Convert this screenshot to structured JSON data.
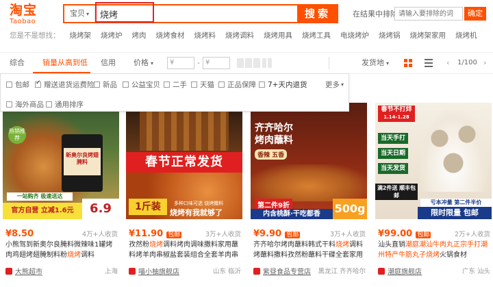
{
  "logo": {
    "cn": "淘宝",
    "en": "Taobao"
  },
  "search": {
    "category": "宝贝",
    "query": "烧烤",
    "button": "搜索",
    "exclude_label": "在结果中排除",
    "exclude_placeholder": "请输入要排除的词",
    "exclude_button": "确定"
  },
  "suggestions": {
    "label": "您是不是想找：",
    "items": [
      "烧烤架",
      "烧烤炉",
      "烤肉",
      "烧烤食材",
      "烧烤料",
      "烧烤调料",
      "烧烤用具",
      "烧烤工具",
      "电烧烤炉",
      "烧烤锅",
      "烧烤架家用",
      "烧烤机"
    ]
  },
  "sort": {
    "items": [
      "综合",
      "销量从高到低",
      "信用",
      "价格"
    ],
    "price_from": "¥",
    "price_to": "¥",
    "dash": "-",
    "ship_from": "发货地",
    "page": "1/100",
    "active_color": "#ff5000"
  },
  "filters": {
    "row1": [
      "包邮",
      "赠送退货运费险",
      "新品",
      "公益宝贝",
      "二手",
      "天猫",
      "正品保障",
      "7+天内退货"
    ],
    "more": "更多",
    "row2": [
      "海外商品",
      "通用排序"
    ],
    "checked_index": 1
  },
  "products": [
    {
      "price": "8.50",
      "sales": "4万+人收货",
      "title_pre": "小熊驾到新奥尔良腌料微辣味1罐烤肉鸡翅烤翅腌制料粉",
      "title_hl": "烧烤",
      "title_post": "调料",
      "shop": "大熊超市",
      "loc": "上海",
      "banner1": "热销推荐",
      "banner2": "官方自营 立减1.6元",
      "banner3": "一站购齐 极速送达",
      "big_price": "6.9",
      "jar_label": "新奥尔良烤翅腌料"
    },
    {
      "price": "11.90",
      "tag": "包邮",
      "sales": "3万+人收货",
      "title_pre": "孜然粉",
      "title_hl": "烧烤",
      "title_post": "调料烤肉调味撒料家用蘸料烤羊肉串椒盐套装组合全套羊肉串",
      "shop": "喵小柚旗舰店",
      "loc": "山东 临沂",
      "banner1": "春节正常发货",
      "banner2": "1斤装",
      "banner3": "烧烤有我就够了",
      "banner4": "多种口味可选 烧烤撒料"
    },
    {
      "price": "9.90",
      "tag": "包邮",
      "sales": "3万+人收货",
      "title_pre": "齐齐哈尔烤肉蘸料韩式干料",
      "title_hl": "烧烤",
      "title_post": "调料烤蘸料撒料孜然粉蘸料干碟全套家用",
      "shop": "紫昼食品专营店",
      "loc": "黑龙江 齐齐哈尔",
      "banner1": "齐齐哈尔",
      "banner2": "烤肉蘸料",
      "banner3": "香辣 五香",
      "banner4": "第二件9折",
      "banner5": "内含桃酥·干吃都香",
      "banner6": "500g"
    },
    {
      "price": "99.00",
      "tag": "包邮",
      "sales": "2万+人收货",
      "title_pre": "汕头直销",
      "title_hl2": "潮庭潮汕牛肉丸正宗手打潮州特产牛筋丸子",
      "title_hl": "烧烤",
      "title_post": "火锅食材",
      "shop": "潮庭旗舰店",
      "loc": "广东 汕头",
      "banner1": "春节不打烊",
      "banner2": "1.14-1.28",
      "banner3": [
        "当天手打",
        "当天日期",
        "当天发货"
      ],
      "banner4": "满2件送 顺丰包邮",
      "banner5": "亏本冲量 第二件半价",
      "banner6": "限时限量 包邮"
    }
  ]
}
